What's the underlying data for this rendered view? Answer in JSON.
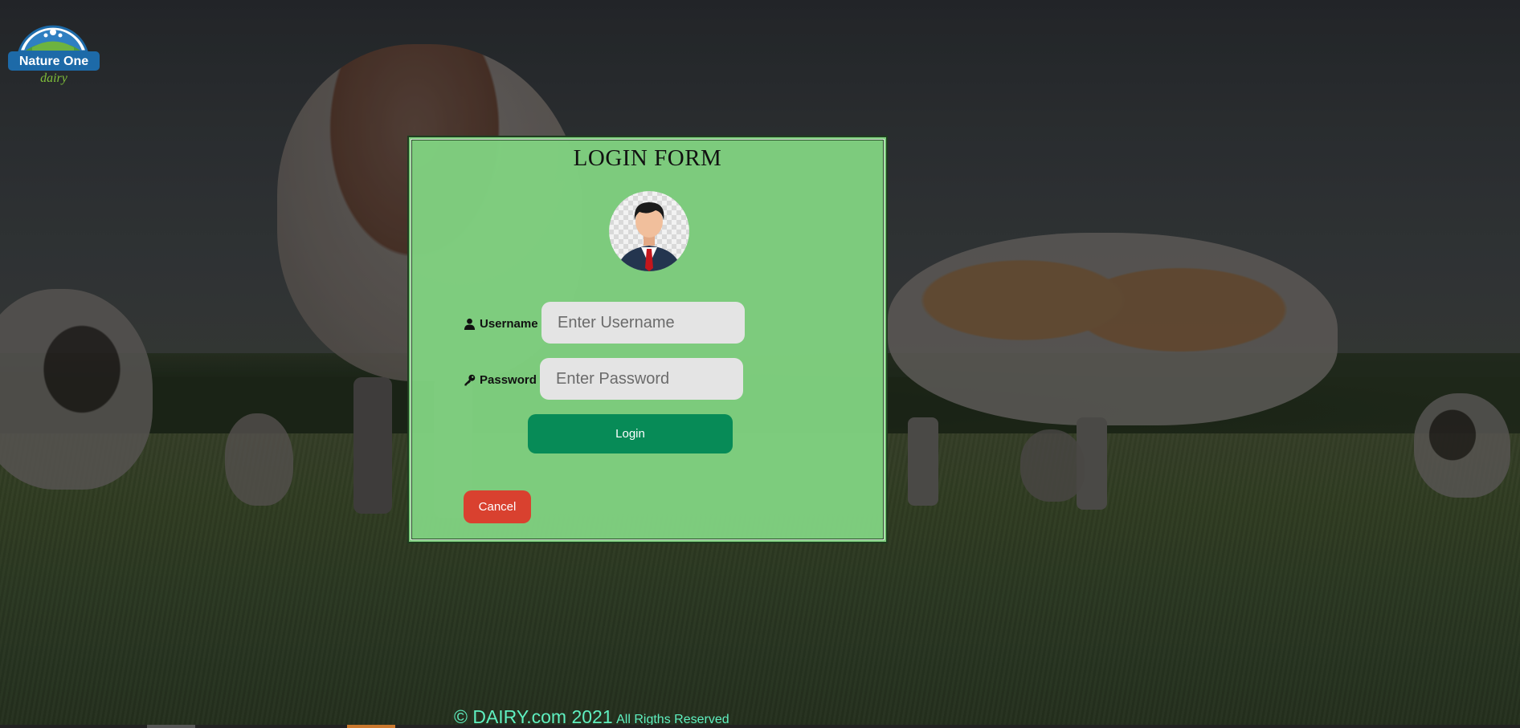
{
  "brand": {
    "logo_line1": "Nature One",
    "logo_line2": "dairy"
  },
  "login_form": {
    "title": "LOGIN FORM",
    "username_label": "Username",
    "username_placeholder": "Enter Username",
    "username_value": "",
    "password_label": "Password",
    "password_placeholder": "Enter Password",
    "password_value": "",
    "login_label": "Login",
    "cancel_label": "Cancel"
  },
  "footer": {
    "copyright": "© DAIRY.com 2021",
    "rights": "All Rigths Reserved"
  },
  "icons": {
    "username": "user-icon",
    "password": "key-icon",
    "avatar": "user-avatar"
  },
  "colors": {
    "panel_bg": "#80d180",
    "login_button": "#078b57",
    "cancel_button": "#d9412f",
    "footer_text": "#5ff0c0"
  }
}
